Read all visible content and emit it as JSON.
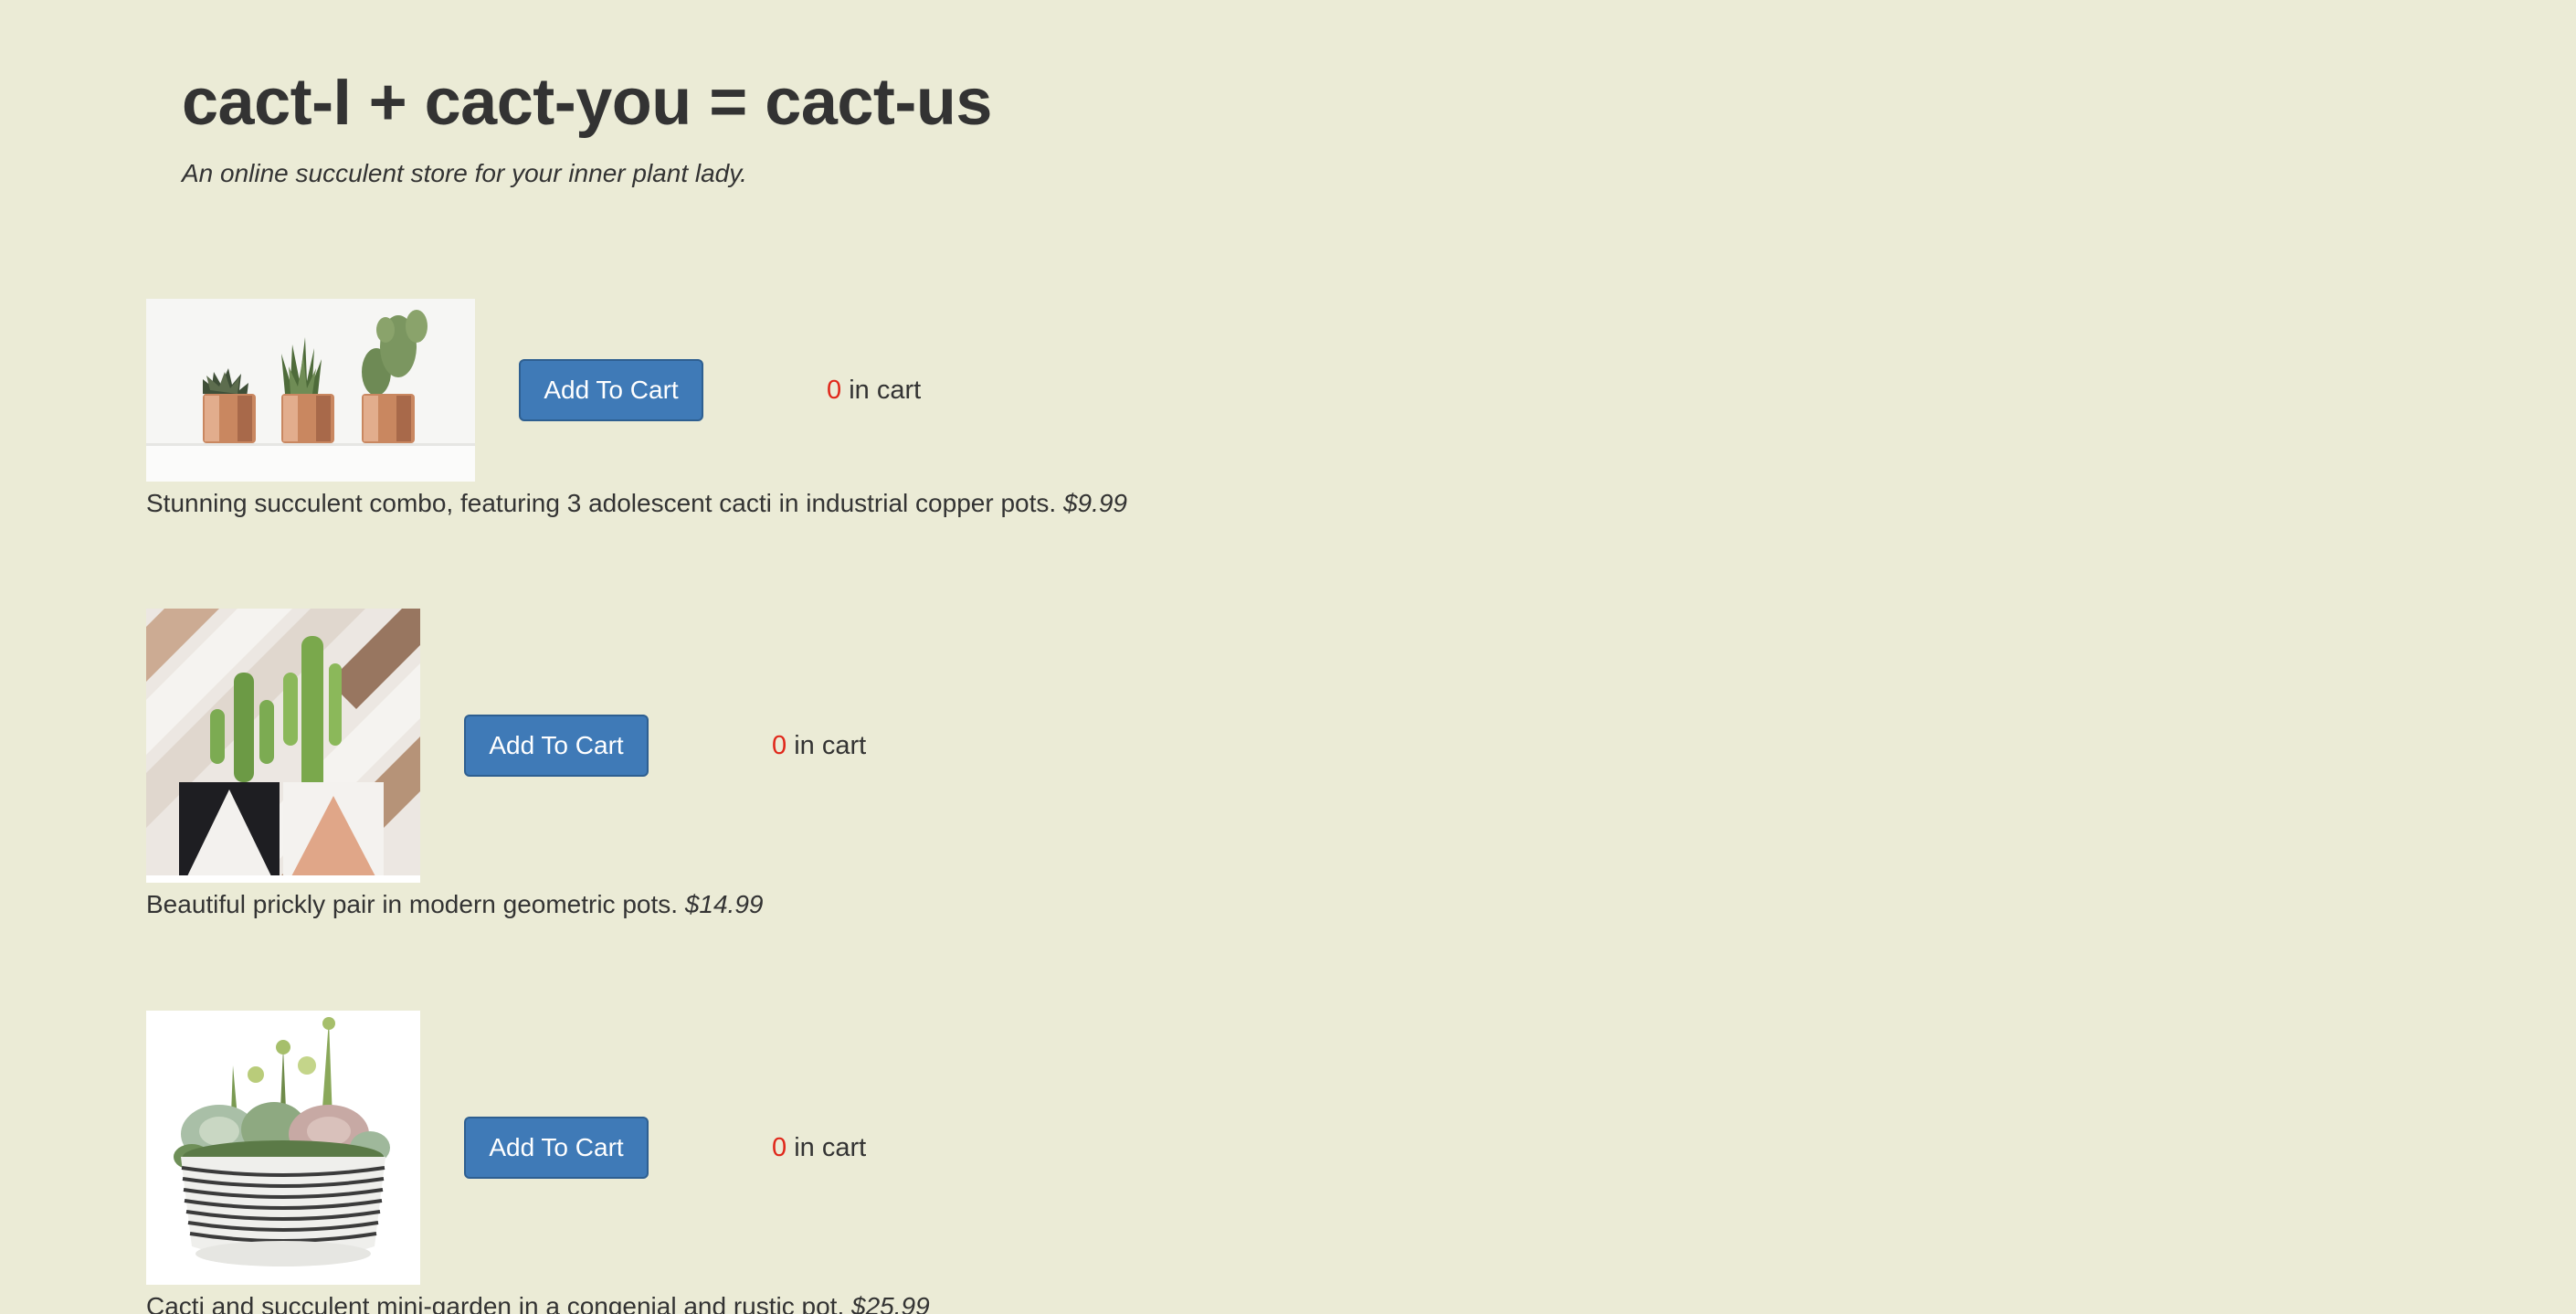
{
  "store": {
    "title": "cact-I + cact-you = cact-us",
    "tagline": "An online succulent store for your inner plant lady."
  },
  "colors": {
    "background": "#ebebd6",
    "button": "#3f7ab7",
    "count": "#e0271a",
    "text": "#333333"
  },
  "products": [
    {
      "image_icon": "copper-pots-cacti-photo",
      "button_label": "Add To Cart",
      "cart_count": "0",
      "cart_suffix": "in cart",
      "description": "Stunning succulent combo, featuring 3 adolescent cacti in industrial copper pots.",
      "price": "$9.99"
    },
    {
      "image_icon": "geometric-pots-cacti-photo",
      "button_label": "Add To Cart",
      "cart_count": "0",
      "cart_suffix": "in cart",
      "description": "Beautiful prickly pair in modern geometric pots.",
      "price": "$14.99"
    },
    {
      "image_icon": "mini-garden-bowl-photo",
      "button_label": "Add To Cart",
      "cart_count": "0",
      "cart_suffix": "in cart",
      "description": "Cacti and succulent mini-garden in a congenial and rustic pot.",
      "price": "$25.99"
    }
  ]
}
